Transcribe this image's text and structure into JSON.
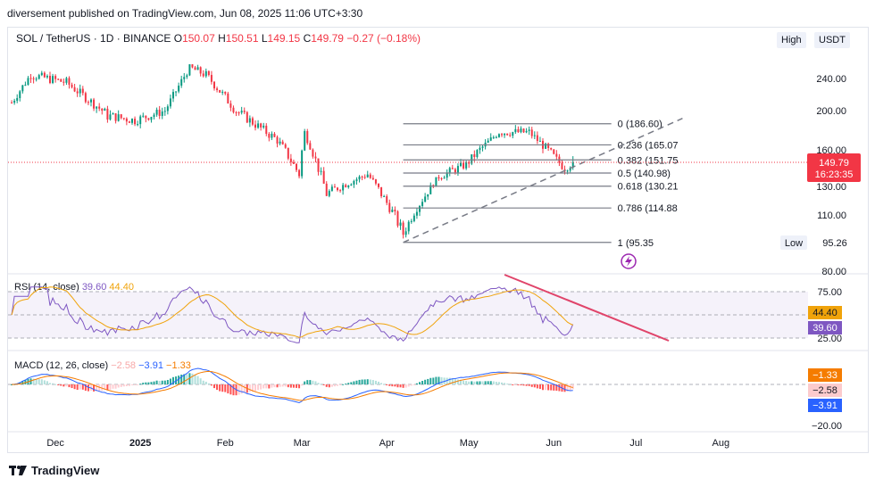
{
  "header": {
    "published": "diversement published on TradingView.com, Jun 08, 2025 11:06 UTC+3:30"
  },
  "symbol": {
    "name": "SOL / TetherUS · 1D · BINANCE",
    "o_label": "O",
    "o": "150.07",
    "h_label": "H",
    "h": "150.51",
    "l_label": "L",
    "l": "149.15",
    "c_label": "C",
    "c": "149.79",
    "change": "−0.27 (−0.18%)"
  },
  "toolbar": {
    "high_label": "High",
    "currency_label": "USDT"
  },
  "rsi": {
    "label": "RSI (14, close)",
    "value": "39.60",
    "ma_value": "44.40",
    "axis": [
      "75.00",
      "25.00"
    ],
    "badge_ma": "44.40",
    "badge_val": "39.60"
  },
  "macd": {
    "label": "MACD (12, 26, close)",
    "hist": "−2.58",
    "macd": "−3.91",
    "signal": "−1.33",
    "axis": [
      "−20.00"
    ],
    "badges": [
      "−1.33",
      "−2.58",
      "−3.91"
    ]
  },
  "price_axis": {
    "ticks": [
      "240.00",
      "200.00",
      "160.00",
      "130.00",
      "110.00",
      "80.00"
    ],
    "last": "149.79",
    "countdown": "16:23:35",
    "low_label": "Low",
    "low_value": "95.26"
  },
  "fib": {
    "levels": [
      {
        "ratio": 0,
        "label": "0 (186.60)",
        "price": 186.6
      },
      {
        "ratio": 0.236,
        "label": "0.236 (165.07",
        "price": 165.07
      },
      {
        "ratio": 0.382,
        "label": "0.382 (151.75",
        "price": 151.75
      },
      {
        "ratio": 0.5,
        "label": "0.5 (140.98)",
        "price": 140.98
      },
      {
        "ratio": 0.618,
        "label": "0.618 (130.21",
        "price": 130.21
      },
      {
        "ratio": 0.786,
        "label": "0.786 (114.88",
        "price": 114.88
      },
      {
        "ratio": 1,
        "label": "1 (95.35",
        "price": 95.35
      }
    ]
  },
  "time_axis": {
    "labels": [
      "Dec",
      "2025",
      "Feb",
      "Mar",
      "Apr",
      "May",
      "Jun",
      "Jul",
      "Aug"
    ]
  },
  "colors": {
    "up": "#089981",
    "down": "#f23645",
    "rsi": "#7e57c2",
    "rsi_ma": "#f0a30a",
    "macd": "#2962ff",
    "signal": "#f57c00",
    "trend": "#e0446a"
  },
  "chart_data": {
    "type": "candlestick",
    "title": "SOL / TetherUS · 1D · BINANCE",
    "last_close": 149.79,
    "ylim": [
      80,
      260
    ],
    "swing_high": 186.6,
    "swing_low": 95.35,
    "x_range": [
      "2024-11-14",
      "2025-08-10"
    ],
    "price_path_anchors": [
      {
        "date": "2024-11-15",
        "close": 210
      },
      {
        "date": "2024-11-22",
        "close": 245
      },
      {
        "date": "2024-12-05",
        "close": 235
      },
      {
        "date": "2024-12-20",
        "close": 195
      },
      {
        "date": "2024-12-30",
        "close": 190
      },
      {
        "date": "2025-01-10",
        "close": 200
      },
      {
        "date": "2025-01-19",
        "close": 255
      },
      {
        "date": "2025-01-25",
        "close": 245
      },
      {
        "date": "2025-02-05",
        "close": 200
      },
      {
        "date": "2025-02-20",
        "close": 170
      },
      {
        "date": "2025-02-28",
        "close": 140
      },
      {
        "date": "2025-03-02",
        "close": 178
      },
      {
        "date": "2025-03-10",
        "close": 125
      },
      {
        "date": "2025-03-25",
        "close": 140
      },
      {
        "date": "2025-04-07",
        "close": 100
      },
      {
        "date": "2025-04-20",
        "close": 138
      },
      {
        "date": "2025-04-30",
        "close": 148
      },
      {
        "date": "2025-05-12",
        "close": 178
      },
      {
        "date": "2025-05-23",
        "close": 178
      },
      {
        "date": "2025-06-01",
        "close": 154
      },
      {
        "date": "2025-06-05",
        "close": 145
      },
      {
        "date": "2025-06-08",
        "close": 149.79
      }
    ]
  }
}
